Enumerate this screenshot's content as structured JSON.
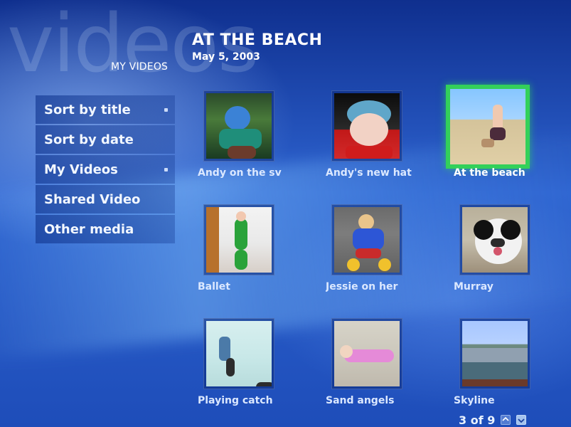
{
  "header": {
    "watermark_text": "videos",
    "section_label": "MY VIDEOS",
    "title": "AT THE BEACH",
    "subtitle": "May 5, 2003"
  },
  "menu": {
    "items": [
      {
        "label": "Sort by title",
        "has_dot": true
      },
      {
        "label": "Sort by date",
        "has_dot": false
      },
      {
        "label": "My Videos",
        "has_dot": true
      },
      {
        "label": "Shared Video",
        "has_dot": false
      },
      {
        "label": "Other media",
        "has_dot": false
      }
    ]
  },
  "grid": {
    "selected_index": 2,
    "items": [
      {
        "caption": "Andy on the sv"
      },
      {
        "caption": "Andy's new hat"
      },
      {
        "caption": "At the beach"
      },
      {
        "caption": "Ballet"
      },
      {
        "caption": "Jessie on her"
      },
      {
        "caption": "Murray"
      },
      {
        "caption": "Playing catch"
      },
      {
        "caption": "Sand angels"
      },
      {
        "caption": "Skyline"
      }
    ]
  },
  "pager": {
    "text": "3 of 9"
  },
  "colors": {
    "selection": "#33d05a"
  },
  "icons": {
    "page_prev": "chevron-up-icon",
    "page_next": "chevron-down-icon"
  }
}
